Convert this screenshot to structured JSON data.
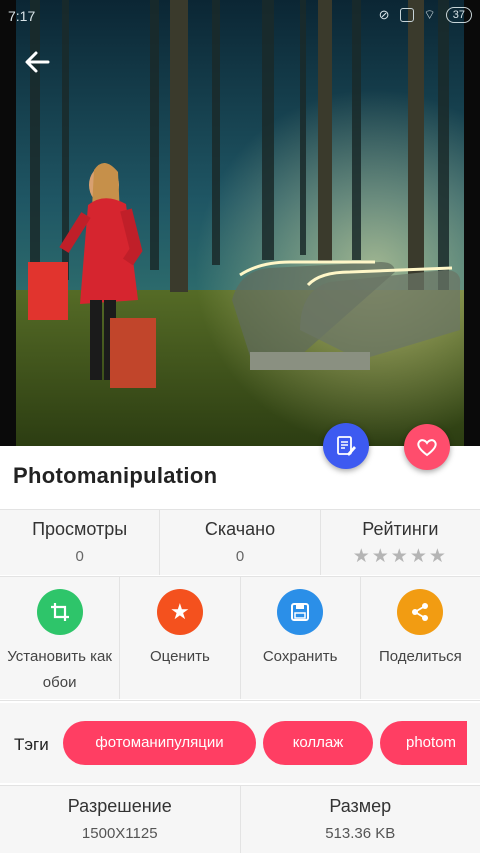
{
  "status_bar": {
    "time": "7:17",
    "battery": "37"
  },
  "wallpaper": {
    "title": "Photomanipulation"
  },
  "stats": [
    {
      "label": "Просмотры",
      "value": "0"
    },
    {
      "label": "Скачано",
      "value": "0"
    },
    {
      "label": "Рейтинги",
      "stars": 5,
      "rating": 0
    }
  ],
  "actions": [
    {
      "label": "Установить как обои",
      "color": "#2ec56a",
      "icon": "crop-icon"
    },
    {
      "label": "Оценить",
      "color": "#f4511e",
      "icon": "star-icon"
    },
    {
      "label": "Сохранить",
      "color": "#2b8fe8",
      "icon": "save-icon"
    },
    {
      "label": "Поделиться",
      "color": "#f29c12",
      "icon": "share-icon"
    }
  ],
  "tags": {
    "label": "Тэги",
    "items": [
      "фотоманипуляции",
      "коллаж",
      "photom"
    ]
  },
  "info": [
    {
      "label": "Разрешение",
      "value": "1500X1125"
    },
    {
      "label": "Размер",
      "value": "513.36 KB"
    }
  ],
  "colors": {
    "accent_pink": "#ff3e63",
    "set_fab": "#3d5af1",
    "fav_fab": "#ff4d6d"
  }
}
